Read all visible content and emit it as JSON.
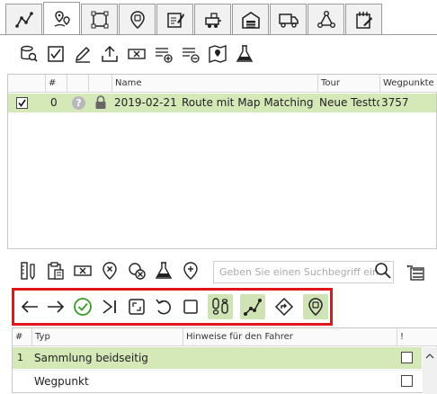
{
  "tabs": [
    {
      "icon": "route-graph-icon"
    },
    {
      "icon": "waypoints-icon",
      "active": true
    },
    {
      "icon": "area-select-icon"
    },
    {
      "icon": "location-pin-icon"
    },
    {
      "icon": "edit-form-icon"
    },
    {
      "icon": "vehicle-cart-icon"
    },
    {
      "icon": "depot-building-icon"
    },
    {
      "icon": "truck-icon"
    },
    {
      "icon": "network-nodes-icon"
    },
    {
      "icon": "notepad-icon"
    }
  ],
  "route_table": {
    "columns": [
      "#",
      "",
      "",
      "Name",
      "Tour",
      "Wegpunkte"
    ],
    "rows": [
      {
        "checked": true,
        "number": "0",
        "date": "2019-02-21",
        "name": "Route mit Map Matching",
        "tour": "Neue Testto",
        "waypoints": "3757"
      }
    ]
  },
  "search": {
    "placeholder": "Geben Sie einen Suchbegriff ein"
  },
  "waypoint_table": {
    "columns": [
      "#",
      "Typ",
      "Hinweise für den Fahrer",
      "!"
    ],
    "rows": [
      {
        "number": "1",
        "type": "Sammlung beidseitig",
        "hint": ""
      },
      {
        "number": "",
        "type": "Wegpunkt",
        "hint": ""
      }
    ]
  },
  "colors": {
    "highlight_row": "#d5e8b8",
    "active_button_bg": "#cfe3b4",
    "annotation_red": "#e0161c",
    "ok_green": "#3a9a2a"
  }
}
